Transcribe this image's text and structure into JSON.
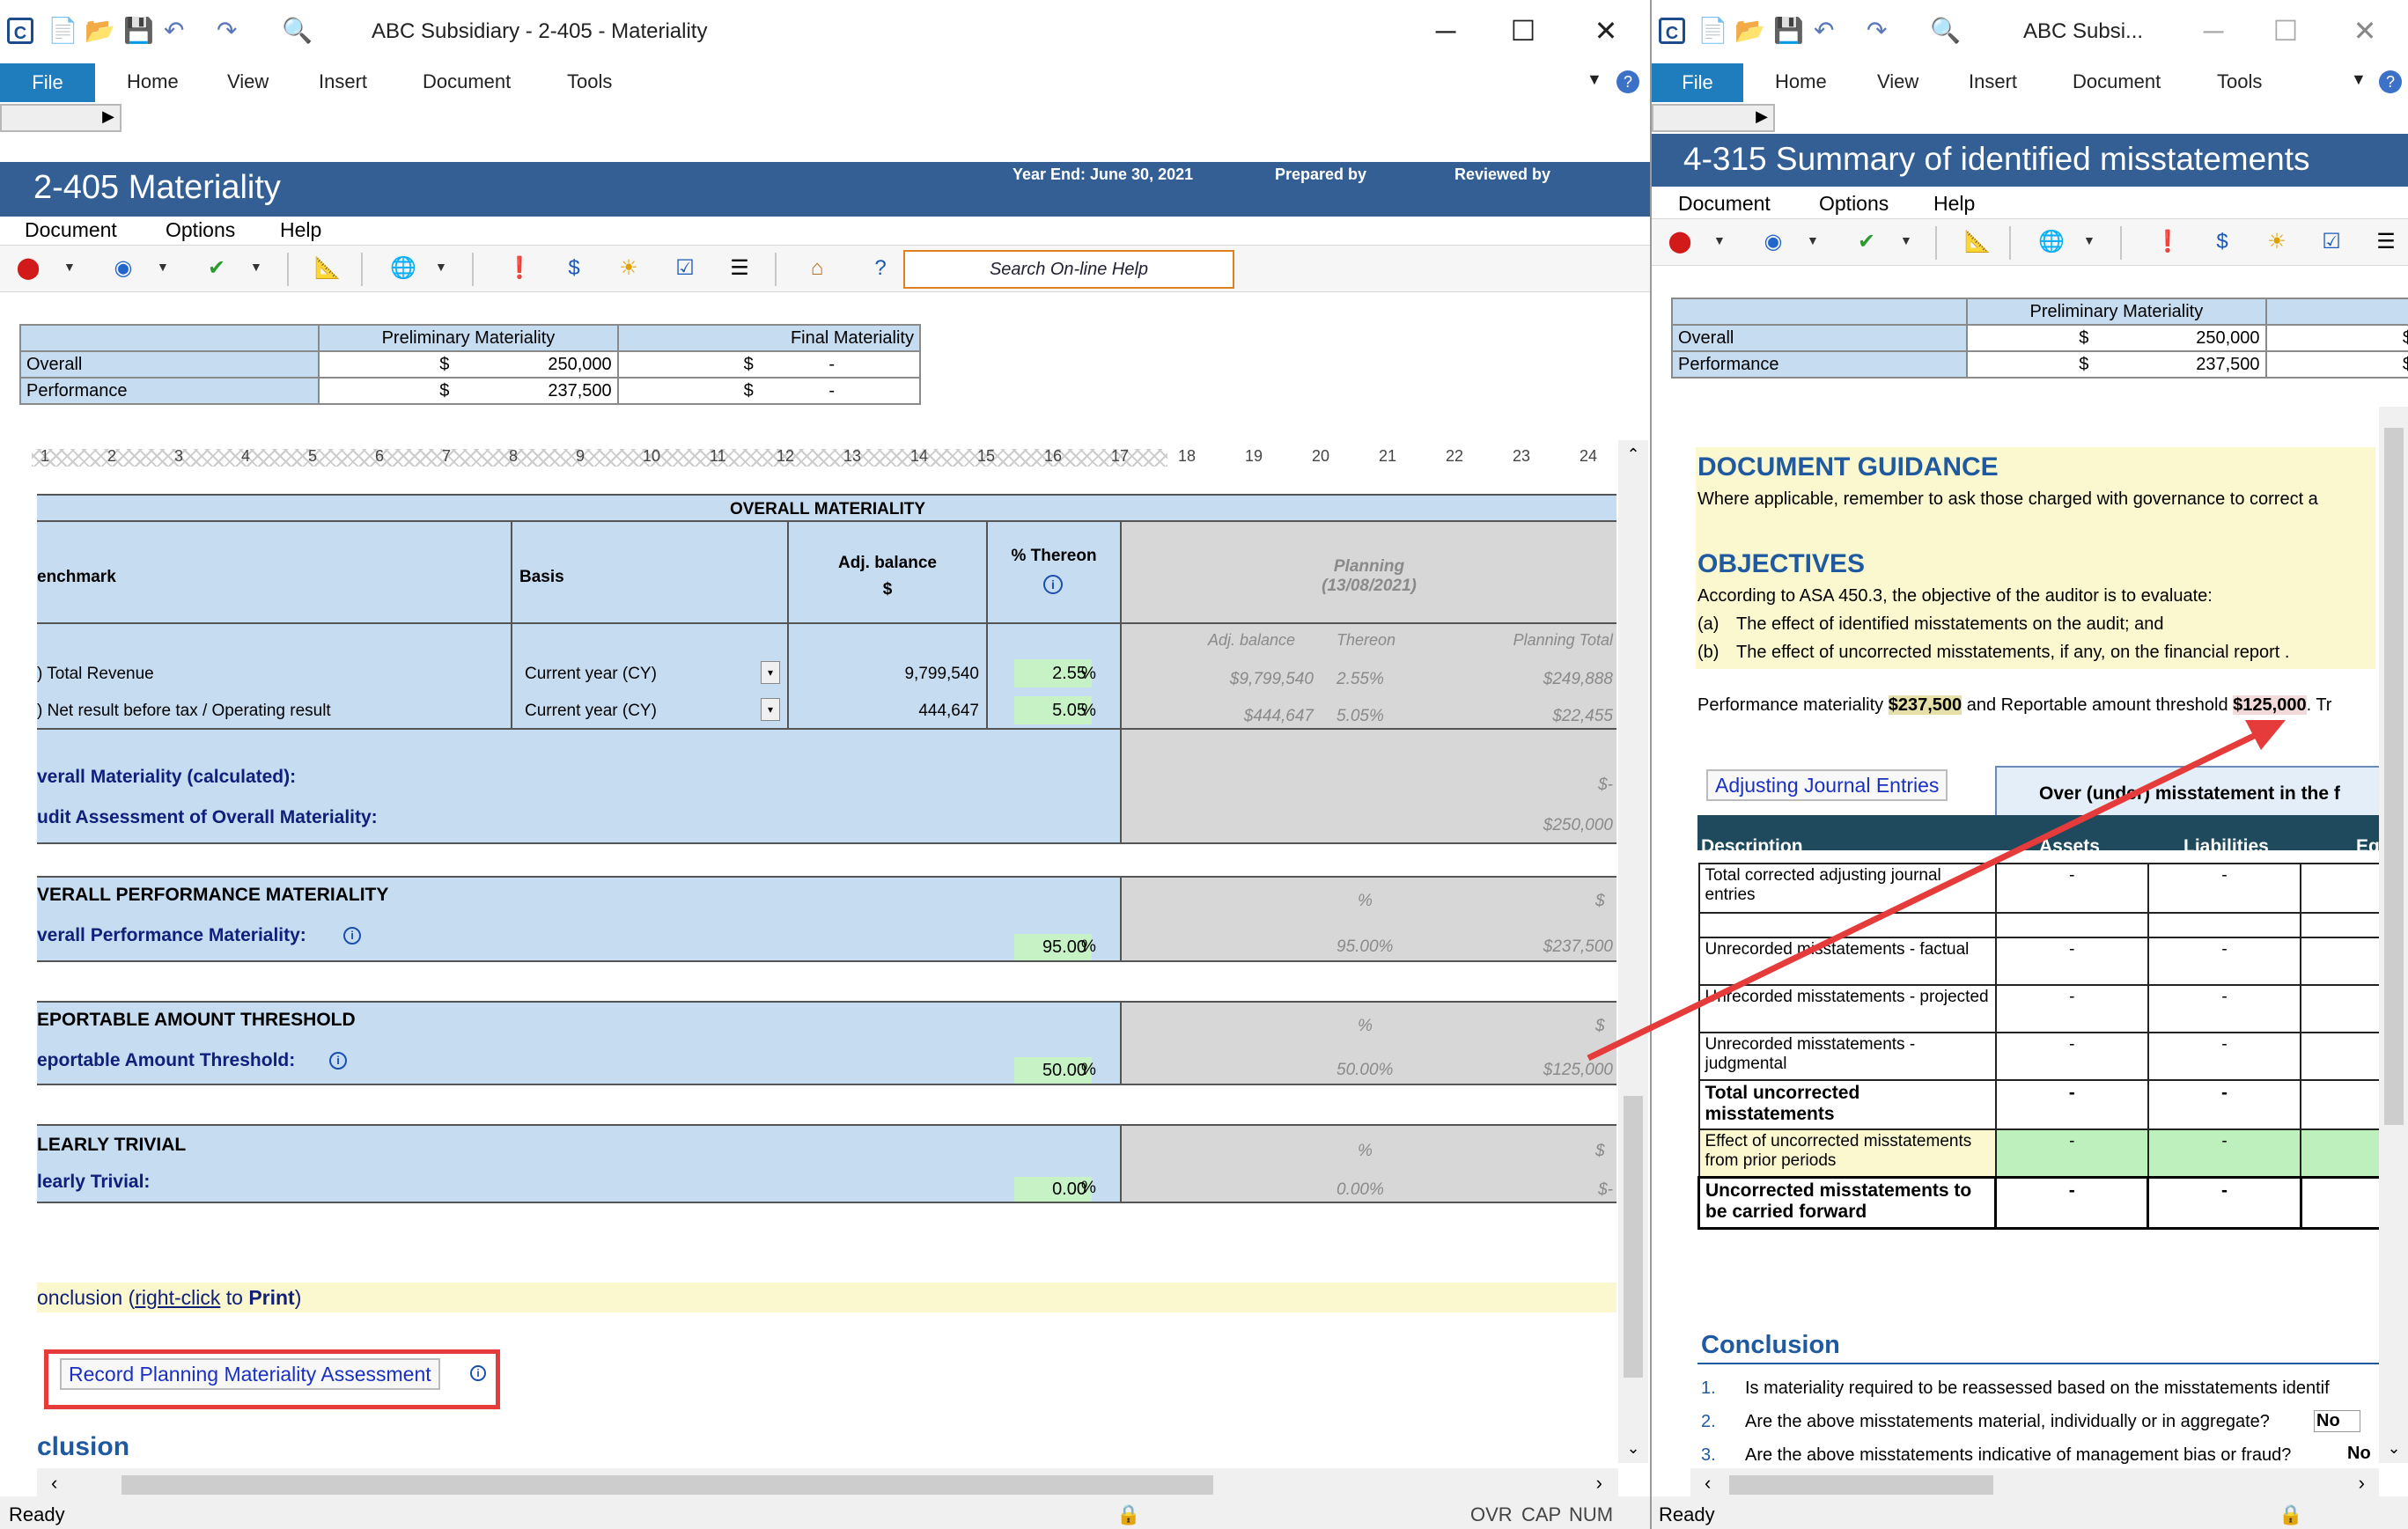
{
  "left": {
    "title": "ABC Subsidiary - 2-405 - Materiality",
    "ribbon_tabs": [
      "File",
      "Home",
      "View",
      "Insert",
      "Document",
      "Tools"
    ],
    "doc_title": "2-405 Materiality",
    "year_end": "Year End:  June 30, 2021",
    "prepared_by": "Prepared by",
    "reviewed_by": "Reviewed by",
    "menu": [
      "Document",
      "Options",
      "Help"
    ],
    "search_help": "Search On-line Help",
    "mat_summary": {
      "prelim": "Preliminary Materiality",
      "final": "Final Materiality",
      "rows": [
        {
          "label": "Overall",
          "cur": "$",
          "prelim": "250,000",
          "cur2": "$",
          "final": "-"
        },
        {
          "label": "Performance",
          "cur": "$",
          "prelim": "237,500",
          "cur2": "$",
          "final": "-"
        }
      ]
    },
    "ruler_numbers": [
      "1",
      "2",
      "3",
      "4",
      "5",
      "6",
      "7",
      "8",
      "9",
      "10",
      "11",
      "12",
      "13",
      "14",
      "15",
      "16",
      "17",
      "18",
      "19",
      "20",
      "21",
      "22",
      "23",
      "24"
    ],
    "overall": {
      "header": "OVERALL MATERIALITY",
      "col_benchmark": "enchmark",
      "col_basis": "Basis",
      "col_adj": "Adj. balance",
      "col_adj_unit": "$",
      "col_pct": "% Thereon",
      "planning": "Planning",
      "planning_date": "(13/08/2021)",
      "sub_adj": "Adj. balance",
      "sub_thereon": "Thereon",
      "sub_total": "Planning Total",
      "rows": [
        {
          "bench": ") Total Revenue",
          "basis": "Current year (CY)",
          "adj": "9,799,540",
          "pct": "2.55",
          "pct_sym": "%",
          "p_adj": "$9,799,540",
          "p_pct": "2.55%",
          "p_total": "$249,888"
        },
        {
          "bench": ") Net result before tax / Operating result",
          "basis": "Current year (CY)",
          "adj": "444,647",
          "pct": "5.05",
          "pct_sym": "%",
          "p_adj": "$444,647",
          "p_pct": "5.05%",
          "p_total": "$22,455"
        }
      ],
      "calc_label": "verall Materiality (calculated):",
      "calc_val": "$-",
      "assess_label": "udit Assessment of Overall Materiality:",
      "assess_val": "$250,000"
    },
    "sections": [
      {
        "header": "VERALL PERFORMANCE MATERIALITY",
        "label": "verall Performance Materiality:",
        "pct": "95.00",
        "pct_sym": "%",
        "p_head_pct": "%",
        "p_head_cur": "$",
        "p_pct": "95.00%",
        "p_val": "$237,500"
      },
      {
        "header": "EPORTABLE AMOUNT THRESHOLD",
        "label": "eportable Amount Threshold:",
        "pct": "50.00",
        "pct_sym": "%",
        "p_head_pct": "%",
        "p_head_cur": "$",
        "p_pct": "50.00%",
        "p_val": "$125,000"
      },
      {
        "header": "LEARLY TRIVIAL",
        "label": "learly Trivial:",
        "pct": "0.00",
        "pct_sym": "%",
        "p_head_pct": "%",
        "p_head_cur": "$",
        "p_pct": "0.00%",
        "p_val": "$-"
      }
    ],
    "conclusion_a": "onclusion (",
    "conclusion_link": "right-click",
    "conclusion_b": " to ",
    "conclusion_print": "Print",
    "conclusion_c": ")",
    "record_button": "Record Planning Materiality Assessment",
    "clusion": "clusion",
    "status": {
      "ready": "Ready",
      "ovr": "OVR",
      "cap": "CAP",
      "num": "NUM"
    }
  },
  "right": {
    "title": "ABC Subsi...",
    "ribbon_tabs": [
      "File",
      "Home",
      "View",
      "Insert",
      "Document",
      "Tools"
    ],
    "doc_title": "4-315 Summary of identified misstatements",
    "menu": [
      "Document",
      "Options",
      "Help"
    ],
    "mat_summary": {
      "prelim": "Preliminary Materiality",
      "rows": [
        {
          "label": "Overall",
          "cur": "$",
          "prelim": "250,000",
          "cur2": "$"
        },
        {
          "label": "Performance",
          "cur": "$",
          "prelim": "237,500",
          "cur2": "$"
        }
      ]
    },
    "guidance_head": "DOCUMENT GUIDANCE",
    "guidance_text": "Where applicable, remember to ask those charged with governance to correct a",
    "objectives_head": "OBJECTIVES",
    "objectives_text": "According to ASA 450.3, the objective of the auditor is to evaluate:",
    "obj_a_key": "(a)",
    "obj_a": "The effect of identified misstatements on the audit; and",
    "obj_b_key": "(b)",
    "obj_b": "The effect of uncorrected misstatements, if any, on the financial report .",
    "perf_text_a": "Performance materiality ",
    "perf_val": "$237,500",
    "perf_text_b": " and Reportable amount threshold ",
    "rep_val": "$125,000",
    "perf_text_c": ". Tr",
    "aje_button": "Adjusting Journal Entries",
    "over_under": "Over (under) misstatement in the f",
    "cols": {
      "desc": "Description",
      "assets": "Assets",
      "liab": "Liabilities",
      "eq": "Eq"
    },
    "rows": [
      {
        "desc": "Total corrected adjusting journal entries",
        "a": "-",
        "l": "-"
      },
      {
        "desc": "",
        "a": "",
        "l": ""
      },
      {
        "desc": "Unrecorded misstatements - factual",
        "a": "-",
        "l": "-"
      },
      {
        "desc": "Unrecorded misstatements - projected",
        "a": "-",
        "l": "-"
      },
      {
        "desc": "Unrecorded misstatements - judgmental",
        "a": "-",
        "l": "-"
      },
      {
        "desc": "Total uncorrected misstatements",
        "a": "-",
        "l": "-"
      },
      {
        "desc": "Effect of uncorrected misstatements from prior periods",
        "a": "-",
        "l": "-"
      },
      {
        "desc": "Uncorrected misstatements to be carried forward",
        "a": "-",
        "l": "-"
      }
    ],
    "conclusion_head": "Conclusion",
    "questions": [
      {
        "n": "1.",
        "q": "Is materiality required to be reassessed based on the misstatements identif",
        "a": ""
      },
      {
        "n": "2.",
        "q": "Are the above misstatements material, individually or in aggregate?",
        "a": "No"
      },
      {
        "n": "3.",
        "q": "Are the above misstatements indicative of management bias or fraud?",
        "a": "No"
      }
    ],
    "status_ready": "Ready"
  },
  "colors": {
    "header_blue": "#345f95",
    "cell_blue": "#c6dcf0",
    "cell_green": "#c6f2c6",
    "cell_yellow": "#fbf8cf",
    "arrow_red": "#e63b3b",
    "file_tab": "#1f7dbe"
  },
  "icons": [
    "app-icon",
    "new-icon",
    "open-icon",
    "save-icon",
    "undo-icon",
    "redo-icon",
    "print-preview-icon",
    "stop-icon",
    "cycle-icon",
    "check-icon",
    "ruler-icon",
    "globe-icon",
    "info-doc-icon",
    "dollar-icon",
    "sun-icon",
    "signoff-icon",
    "insert-row-icon",
    "home-icon",
    "help-icon",
    "lock-icon"
  ]
}
